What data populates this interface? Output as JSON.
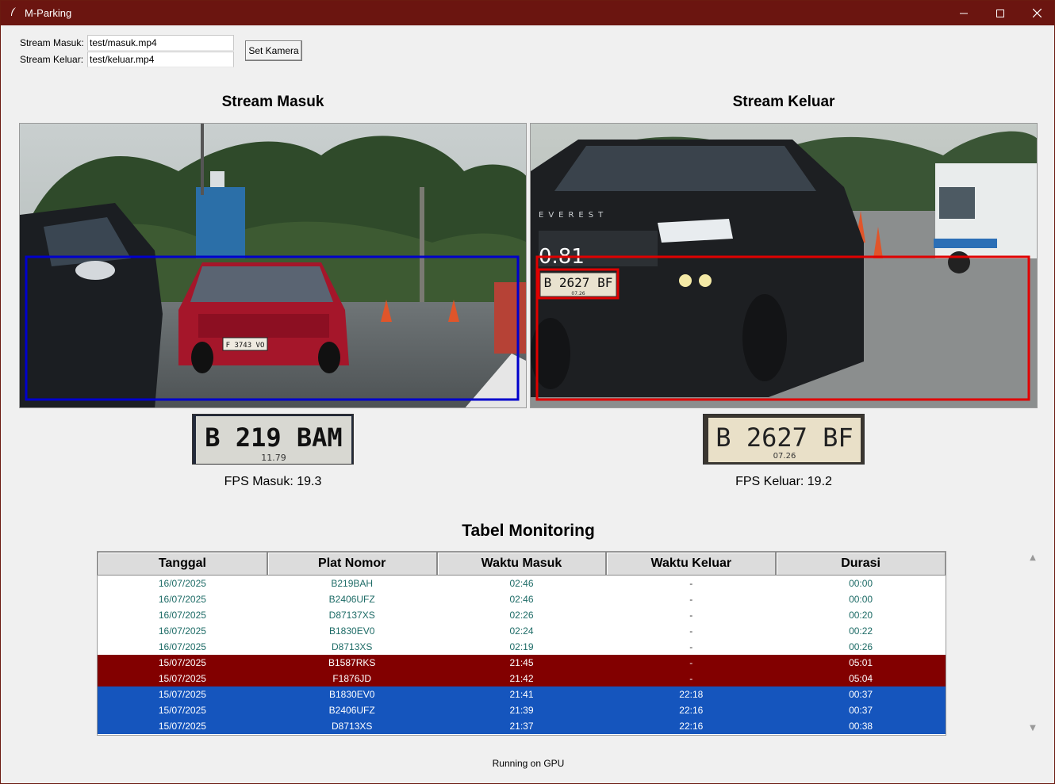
{
  "window": {
    "title": "M-Parking",
    "minimize_glyph": "—",
    "close_glyph": "✕"
  },
  "form": {
    "stream_masuk_label": "Stream Masuk:",
    "stream_masuk_value": "test/masuk.mp4",
    "stream_keluar_label": "Stream Keluar:",
    "stream_keluar_value": "test/keluar.mp4",
    "set_button": "Set Kamera"
  },
  "streams": {
    "masuk": {
      "title": "Stream Masuk",
      "fps_label": "FPS Masuk: 19.3",
      "frame_plate": "F 3743 VO",
      "crop_plate_main": "B 219 BAM",
      "crop_plate_sub": "11.79",
      "box_color": "#0000cc"
    },
    "keluar": {
      "title": "Stream Keluar",
      "fps_label": "FPS Keluar: 19.2",
      "confidence": "0.81",
      "frame_plate": "B 2627 BF",
      "frame_plate_sub": "07.26",
      "brand_text": "EVEREST",
      "crop_plate_main": "B 2627 BF",
      "crop_plate_sub": "07.26",
      "box_color": "#e00000"
    }
  },
  "monitoring": {
    "title": "Tabel Monitoring",
    "columns": [
      "Tanggal",
      "Plat Nomor",
      "Waktu Masuk",
      "Waktu Keluar",
      "Durasi"
    ],
    "rows": [
      {
        "tanggal": "16/07/2025",
        "plat": "B219BAH",
        "masuk": "02:46",
        "keluar": "-",
        "durasi": "00:00",
        "status": "normal"
      },
      {
        "tanggal": "16/07/2025",
        "plat": "B2406UFZ",
        "masuk": "02:46",
        "keluar": "-",
        "durasi": "00:00",
        "status": "normal"
      },
      {
        "tanggal": "16/07/2025",
        "plat": "D87137XS",
        "masuk": "02:26",
        "keluar": "-",
        "durasi": "00:20",
        "status": "normal"
      },
      {
        "tanggal": "16/07/2025",
        "plat": "B1830EV0",
        "masuk": "02:24",
        "keluar": "-",
        "durasi": "00:22",
        "status": "normal"
      },
      {
        "tanggal": "16/07/2025",
        "plat": "D8713XS",
        "masuk": "02:19",
        "keluar": "-",
        "durasi": "00:26",
        "status": "normal"
      },
      {
        "tanggal": "15/07/2025",
        "plat": "B1587RKS",
        "masuk": "21:45",
        "keluar": "-",
        "durasi": "05:01",
        "status": "warn"
      },
      {
        "tanggal": "15/07/2025",
        "plat": "F1876JD",
        "masuk": "21:42",
        "keluar": "-",
        "durasi": "05:04",
        "status": "warn"
      },
      {
        "tanggal": "15/07/2025",
        "plat": "B1830EV0",
        "masuk": "21:41",
        "keluar": "22:18",
        "durasi": "00:37",
        "status": "done"
      },
      {
        "tanggal": "15/07/2025",
        "plat": "B2406UFZ",
        "masuk": "21:39",
        "keluar": "22:16",
        "durasi": "00:37",
        "status": "done"
      },
      {
        "tanggal": "15/07/2025",
        "plat": "D8713XS",
        "masuk": "21:37",
        "keluar": "22:16",
        "durasi": "00:38",
        "status": "done"
      }
    ]
  },
  "status_text": "Running on GPU",
  "colors": {
    "titlebar": "#6b1510",
    "row_warn": "#820000",
    "row_done": "#1555bd",
    "row_normal_text": "#1d6b66"
  }
}
